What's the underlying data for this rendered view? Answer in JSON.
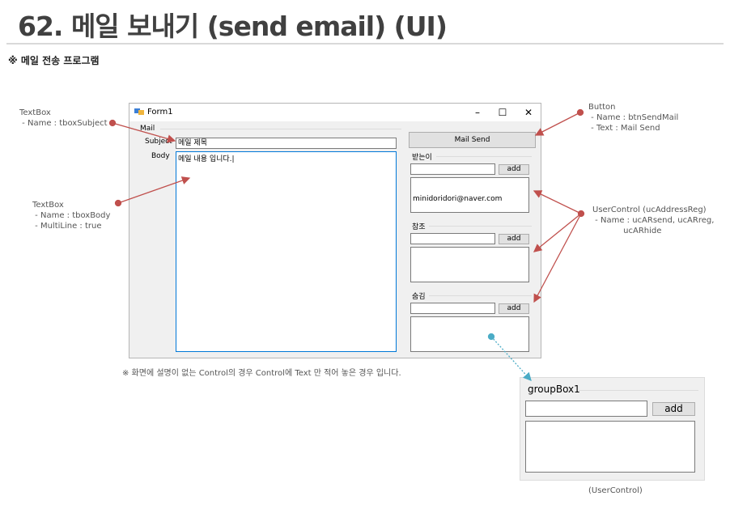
{
  "page": {
    "title": "62. 메일 보내기 (send email) (UI)",
    "subtitle": "※ 메일 전송 프로그램",
    "footnote": "※ 화면에 설명이 없는 Control의 경우 Control에 Text 만 적어 놓은 경우 입니다."
  },
  "annotations": {
    "subject_textbox": "TextBox\n - Name : tboxSubject",
    "body_textbox": "TextBox\n - Name : tboxBody\n - MultiLine : true",
    "send_button": "Button\n - Name : btnSendMail\n - Text : Mail Send",
    "user_control": "UserControl (ucAddressReg)\n - Name : ucARsend, ucARreg,\n            ucARhide",
    "user_control_caption": "(UserControl)"
  },
  "form": {
    "title": "Form1",
    "min_glyph": "–",
    "max_glyph": "☐",
    "close_glyph": "✕",
    "mail_label": "Mail",
    "subject_label": "Subject",
    "subject_value": "메일 제목",
    "body_label": "Body",
    "body_value": "메일 내용 입니다.|",
    "send_button": "Mail Send",
    "groups": [
      {
        "title": "받는이",
        "add_label": "add",
        "input_value": "",
        "list_items": [
          "minidoridori@naver.com"
        ]
      },
      {
        "title": "참조",
        "add_label": "add",
        "input_value": "",
        "list_items": []
      },
      {
        "title": "숨김",
        "add_label": "add",
        "input_value": "",
        "list_items": []
      }
    ]
  },
  "user_control_preview": {
    "title": "groupBox1",
    "add_label": "add",
    "input_value": ""
  },
  "colors": {
    "arrow": "#c0504d",
    "dotted_arrow": "#4bacc6",
    "window_bg": "#f0f0f0"
  }
}
